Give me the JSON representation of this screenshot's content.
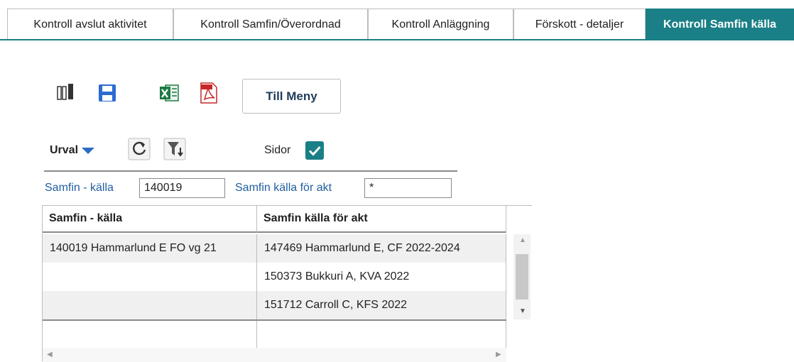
{
  "tabs": [
    {
      "label": "Kontroll avslut aktivitet",
      "active": false
    },
    {
      "label": "Kontroll Samfin/Överordnad",
      "active": false
    },
    {
      "label": "Kontroll Anläggning",
      "active": false
    },
    {
      "label": "Förskott - detaljer",
      "active": false
    },
    {
      "label": "Kontroll Samfin källa",
      "active": true
    }
  ],
  "toolbar": {
    "columns_icon": "columns-icon",
    "save_icon": "save-icon",
    "excel_icon": "excel-icon",
    "pdf_icon": "pdf-icon",
    "menu_button": "Till Meny"
  },
  "selection": {
    "urval_label": "Urval",
    "refresh_icon": "refresh-icon",
    "filter_icon": "filter-sort-icon",
    "sidor_label": "Sidor",
    "sidor_checked": true
  },
  "filters": {
    "kalla_label": "Samfin - källa",
    "kalla_value": "140019",
    "akt_label": "Samfin källa för akt",
    "akt_value": "*"
  },
  "grid": {
    "headers": [
      "Samfin - källa",
      "Samfin källa för akt"
    ],
    "rows": [
      [
        "140019 Hammarlund E FO vg 21",
        "147469 Hammarlund E, CF 2022-2024"
      ],
      [
        "",
        "150373 Bukkuri A, KVA 2022"
      ],
      [
        "",
        "151712 Carroll C, KFS 2022"
      ]
    ]
  },
  "colors": {
    "accent": "#1a7f86",
    "link_blue": "#1f5e9e",
    "caret_blue": "#2b6cc4"
  }
}
